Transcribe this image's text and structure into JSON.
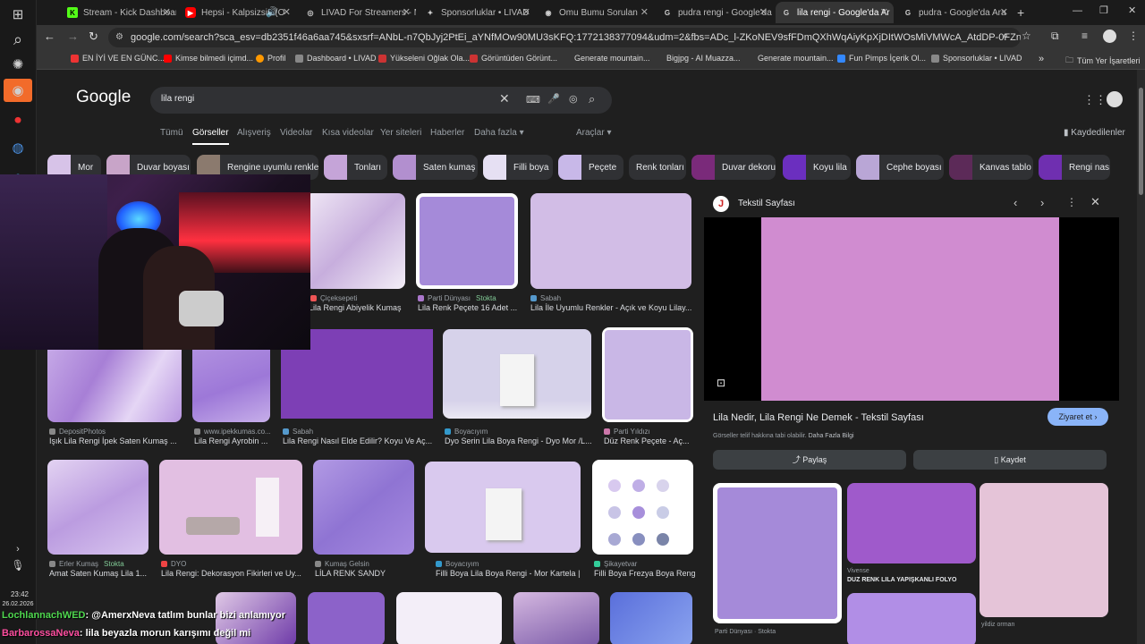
{
  "tabs": [
    {
      "title": "Stream - Kick Dashboard",
      "color": "#53fc18",
      "glyph": "K"
    },
    {
      "title": "Hepsi - Kalpsizsin (O",
      "color": "#ff0000",
      "glyph": "▶"
    },
    {
      "title": "LIVAD For Streamers - M",
      "color": "#cfcfcf",
      "glyph": "◎"
    },
    {
      "title": "Sponsorluklar • LIVAD",
      "color": "#cfcfcf",
      "glyph": "✦"
    },
    {
      "title": "Omu Bumu Sorulan",
      "color": "#cfcfcf",
      "glyph": "◉"
    },
    {
      "title": "pudra rengi - Google'da",
      "color": "#cfcfcf",
      "glyph": "G"
    },
    {
      "title": "lila rengi - Google'da Ar",
      "color": "#cfcfcf",
      "glyph": "G"
    },
    {
      "title": "pudra - Google'da Ara",
      "color": "#cfcfcf",
      "glyph": "G"
    }
  ],
  "url": "google.com/search?sca_esv=db2351f46a6aa745&sxsrf=ANbL-n7QbJyj2PtEi_aYNfMOw90MU3sKFQ:1772138377094&udm=2&fbs=ADc_l-ZKoNEV9sfFDmQXhWqAiyKpXjDItWOsMiVMWcA_AtdDP-0FZnBrqJA-DoJOe1yXZR0a6RaDYW1b...",
  "bookmarks": [
    {
      "label": "EN İYİ VE EN GÜNC...",
      "color": "#e33"
    },
    {
      "label": "Kimse bilmedi içimd...",
      "color": "#f00"
    },
    {
      "label": "Profil",
      "color": "#f90"
    },
    {
      "label": "Dashboard • LIVAD",
      "color": "#888"
    },
    {
      "label": "Yükseleni Oğlak Ola...",
      "color": "#c33"
    },
    {
      "label": "Görüntüden Görünt...",
      "color": "#c33"
    },
    {
      "label": "Generate mountain...",
      "color": "#555"
    },
    {
      "label": "Bigjpg - AI Muazza...",
      "color": "#555"
    },
    {
      "label": "Generate mountain...",
      "color": "#555"
    },
    {
      "label": "Fun Pimps İçerik Ol...",
      "color": "#38f"
    },
    {
      "label": "Sponsorluklar • LIVAD",
      "color": "#888"
    }
  ],
  "bookmarks_all": "Tüm Yer İşaretleri",
  "search_query": "lila rengi",
  "nav_tabs": [
    "Tümü",
    "Görseller",
    "Alışveriş",
    "Videolar",
    "Kısa videolar",
    "Yer siteleri",
    "Haberler",
    "Daha fazla ▾"
  ],
  "tools": "Araçlar ▾",
  "saved": "Kaydedilenler",
  "chips": [
    {
      "label": "Mor",
      "color": "#d7c3e8"
    },
    {
      "label": "Duvar boyası",
      "color": "#c8a4c8"
    },
    {
      "label": "Rengine uyumlu renkler",
      "color": "#8b7a6e"
    },
    {
      "label": "Tonları",
      "color": "#c5a4d8"
    },
    {
      "label": "Saten kumaş",
      "color": "#b28fcf"
    },
    {
      "label": "Filli boya",
      "color": "#e6e0f3"
    },
    {
      "label": "Peçete",
      "color": "#c8b8e8"
    },
    {
      "label": "Renk tonları",
      "color": ""
    },
    {
      "label": "Duvar dekoru",
      "color": "#7a2a7a"
    },
    {
      "label": "Koyu lila",
      "color": "#6b2fbf"
    },
    {
      "label": "Cephe boyası",
      "color": "#b9a6d6"
    },
    {
      "label": "Kanvas tablo",
      "color": "#5c2a58"
    },
    {
      "label": "Rengi nasıl",
      "color": "#6f2fb0"
    }
  ],
  "results": [
    {
      "src": "Çiçeksepeti",
      "cap": "Lila Rengi Abiyelik Kumaş",
      "stok": ""
    },
    {
      "src": "Parti Dünyası",
      "cap": "Lila Renk Peçete 16 Adet ...",
      "stok": "Stokta"
    },
    {
      "src": "Sabah",
      "cap": "Lila İle Uyumlu Renkler - Açık ve Koyu Lilay...",
      "stok": ""
    },
    {
      "src": "DepositPhotos",
      "cap": "Işık Lila Rengi İpek Saten Kumaş ...",
      "stok": ""
    },
    {
      "src": "www.ipekkumas.co...",
      "cap": "Lila Rengi Ayrobin ...",
      "stok": ""
    },
    {
      "src": "Sabah",
      "cap": "Lila Rengi Nasıl Elde Edilir? Koyu Ve Aç...",
      "stok": ""
    },
    {
      "src": "Boyacıyım",
      "cap": "Dyo Serin Lila Boya Rengi - Dyo Mor /L...",
      "stok": ""
    },
    {
      "src": "Parti Yıldızı",
      "cap": "Düz Renk Peçete - Aç...",
      "stok": ""
    },
    {
      "src": "Erler Kumaş",
      "cap": "Amat Saten Kumaş Lila 1...",
      "stok": "Stokta"
    },
    {
      "src": "DYO",
      "cap": "Lila Rengi: Dekorasyon Fikirleri ve Uy...",
      "stok": ""
    },
    {
      "src": "Kumaş Gelsin",
      "cap": "LİLA RENK SANDY",
      "stok": ""
    },
    {
      "src": "Boyacıyım",
      "cap": "Filli Boya Lila Boya Rengi - Mor Kartela | ...",
      "stok": ""
    },
    {
      "src": "Şikayetvar",
      "cap": "Filli Boya Frezya Boya Rengi R...",
      "stok": ""
    }
  ],
  "panel": {
    "site": "Tekstil Sayfası",
    "title": "Lila Nedir, Lila Rengi Ne Demek - Tekstil Sayfası",
    "visit": "Ziyaret et ›",
    "notice": "Görseller telif hakkına tabi olabilir.",
    "more": "Daha Fazla Bilgi",
    "share": "Paylaş",
    "save": "Kaydet",
    "related": [
      {
        "src": "Vivense",
        "cap": "DUZ RENK LILA YAPIŞKANLI FOLYO"
      },
      {
        "src": "yildiz orman",
        "cap": ""
      },
      {
        "src": "Parti Dünyası · Stokta",
        "cap": ""
      }
    ]
  },
  "taskbar": {
    "time": "23:42",
    "date": "26.02.2026"
  },
  "chat": [
    {
      "user": "LochlannachWED",
      "text": ": @AmerxNeva tatlım bunlar bizi anlamıyor",
      "color": "#4fd84f"
    },
    {
      "user": "BarbarossaNeva",
      "text": ": lila beyazla morun karışımı değil mi",
      "color": "#ff4fa0"
    }
  ]
}
